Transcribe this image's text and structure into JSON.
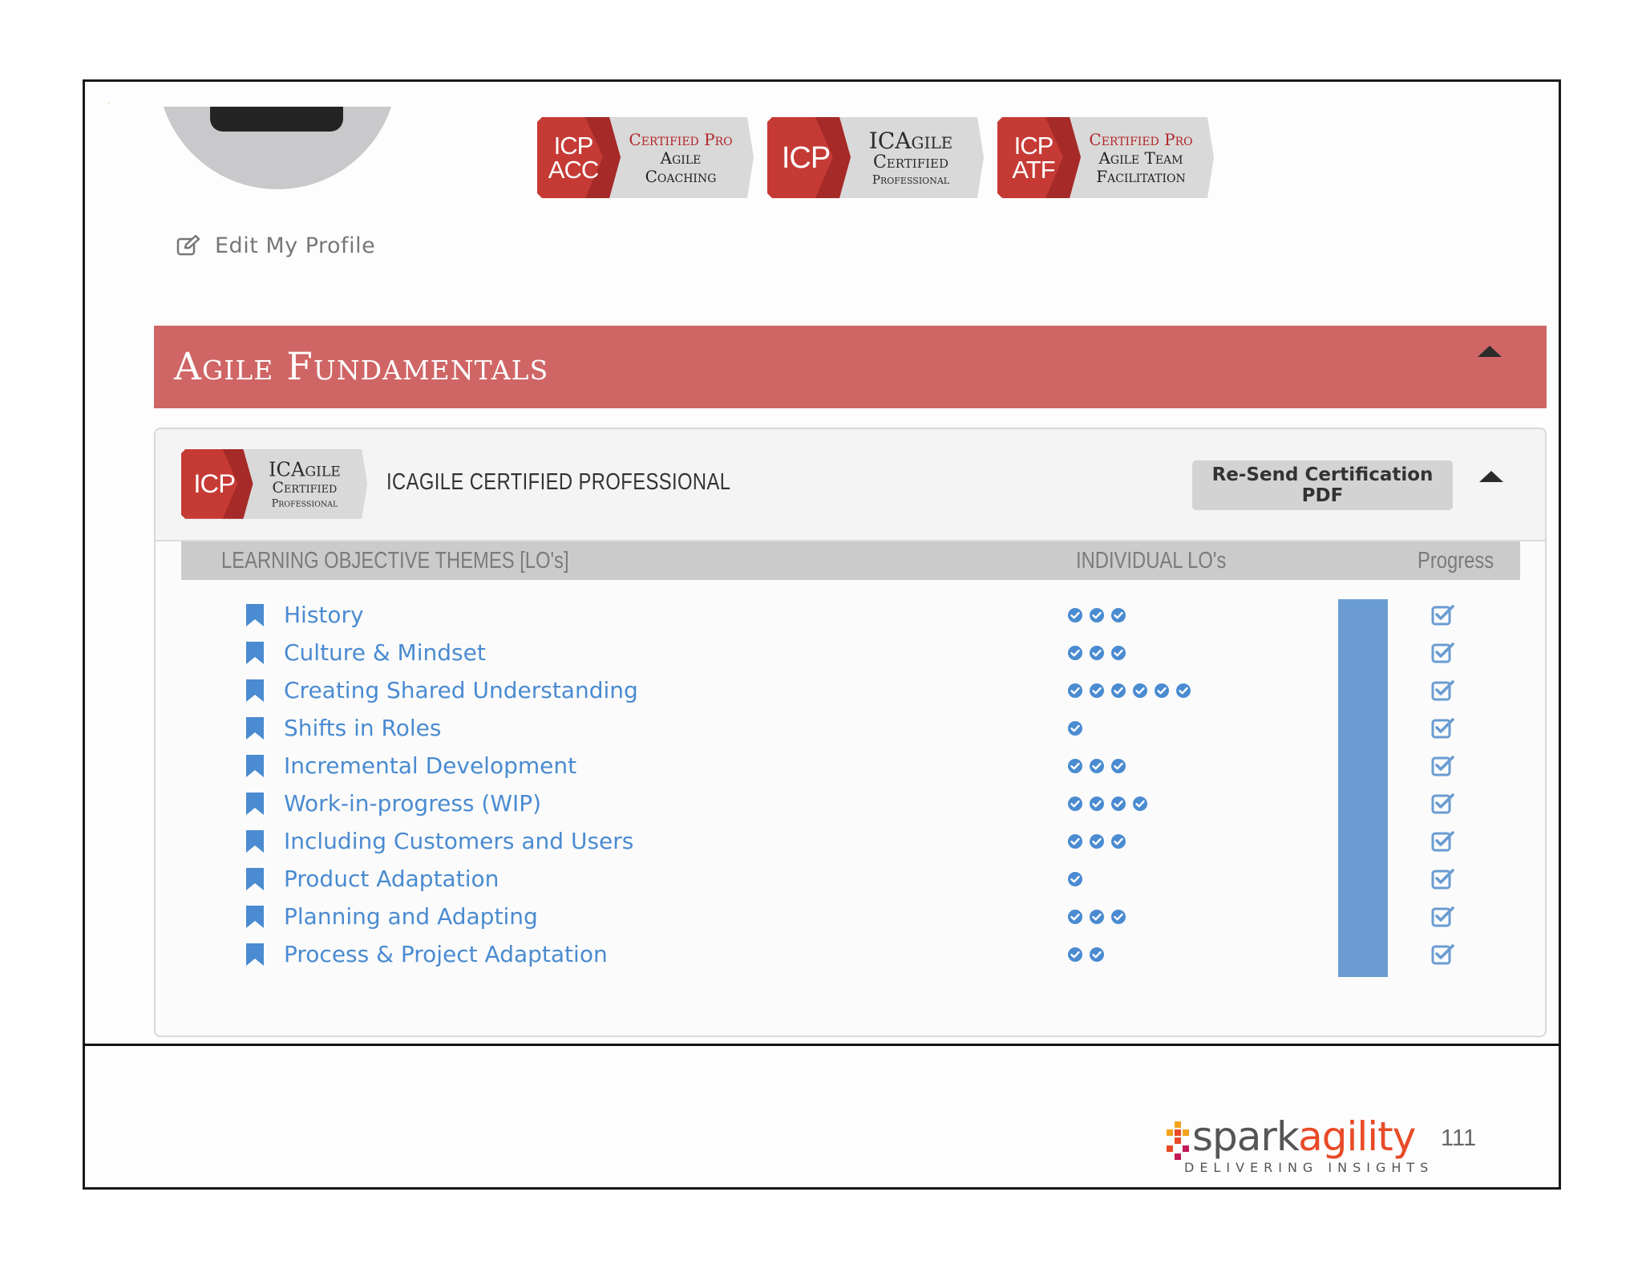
{
  "badges": [
    {
      "code_line1": "ICP",
      "code_line2": "ACC",
      "text_line1": "Certified Pro",
      "text_line2": "Agile",
      "text_line3": "Coaching"
    },
    {
      "code_line1": "ICP",
      "text_line1": "ICAgile",
      "text_line2": "Certified",
      "text_line3": "Professional"
    },
    {
      "code_line1": "ICP",
      "code_line2": "ATF",
      "text_line1": "Certified Pro",
      "text_line2": "Agile Team",
      "text_line3": "Facilitation"
    }
  ],
  "profile": {
    "edit_label": "Edit My Profile"
  },
  "section": {
    "title": "Agile Fundamentals"
  },
  "certification": {
    "badge": {
      "code": "ICP",
      "line1": "ICAgile",
      "line2": "Certified",
      "line3": "Professional"
    },
    "title": "ICAGILE CERTIFIED PROFESSIONAL",
    "resend_label": "Re-Send Certification PDF"
  },
  "table": {
    "col_themes": "LEARNING OBJECTIVE THEMES [LO's]",
    "col_individual": "INDIVIDUAL LO's",
    "col_progress": "Progress",
    "rows": [
      {
        "label": "History",
        "lo_count": 3
      },
      {
        "label": "Culture & Mindset",
        "lo_count": 3
      },
      {
        "label": "Creating Shared Understanding",
        "lo_count": 6
      },
      {
        "label": "Shifts in Roles",
        "lo_count": 1
      },
      {
        "label": "Incremental Development",
        "lo_count": 3
      },
      {
        "label": "Work-in-progress (WIP)",
        "lo_count": 4
      },
      {
        "label": "Including Customers and Users",
        "lo_count": 3
      },
      {
        "label": "Product Adaptation",
        "lo_count": 1
      },
      {
        "label": "Planning and Adapting",
        "lo_count": 3
      },
      {
        "label": "Process & Project Adaptation",
        "lo_count": 2
      }
    ],
    "progress_fraction": 1.0
  },
  "footer": {
    "logo_part1": "spark",
    "logo_part2": "agility",
    "tagline": "DELIVERING INSIGHTS",
    "page_number": "111"
  },
  "colors": {
    "header_red": "#d06566",
    "link_blue": "#4a8bd1",
    "progress_blue": "#6a9cd2",
    "badge_red": "#b3262b"
  },
  "icons": {
    "edit": "edit-icon",
    "bookmark": "bookmark-icon",
    "lo_check": "check-circle-icon",
    "progress_check": "checkbox-checked-icon",
    "collapse": "caret-up-icon"
  }
}
